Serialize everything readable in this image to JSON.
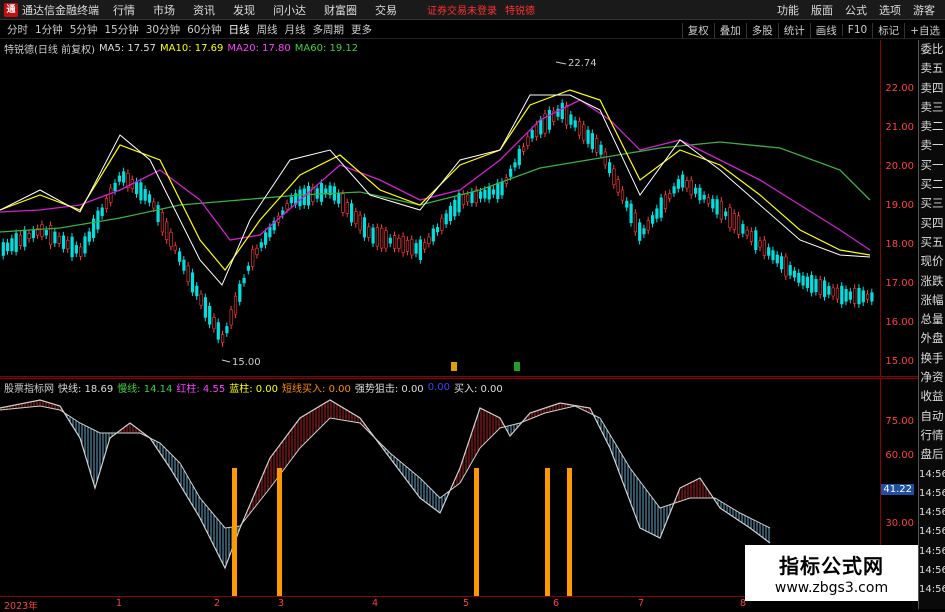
{
  "titlebar": {
    "app_title": "通达信金融终端",
    "logo": "通",
    "menus": [
      "行情",
      "市场",
      "资讯",
      "发现",
      "问小达",
      "财富圈",
      "交易"
    ],
    "alert": "证券交易未登录",
    "alert2": "特锐德",
    "right_menus": [
      "功能",
      "版面",
      "公式",
      "选项"
    ],
    "guest": "游客"
  },
  "periods": [
    "分时",
    "1分钟",
    "5分钟",
    "15分钟",
    "30分钟",
    "60分钟",
    "日线",
    "周线",
    "月线",
    "多周期",
    "更多"
  ],
  "tools": [
    "复权",
    "叠加",
    "多股",
    "统计",
    "画线",
    "F10",
    "标记",
    "+自选"
  ],
  "info": {
    "name": "特锐德(日线 前复权)",
    "ma5": "MA5: 17.57",
    "ma10": "MA10: 17.69",
    "ma20": "MA20: 17.80",
    "ma60": "MA60: 19.12"
  },
  "price_axis": [
    "22.00",
    "21.00",
    "20.00",
    "19.00",
    "18.00",
    "17.00",
    "16.00",
    "15.00"
  ],
  "annotations": {
    "high": "22.74",
    "low": "15.00"
  },
  "right_panel": [
    "委比",
    "卖五",
    "卖四",
    "卖三",
    "卖二",
    "卖一",
    "买一",
    "买二",
    "买三",
    "买四",
    "买五",
    "现价",
    "涨跌",
    "涨幅",
    "总量",
    "外盘",
    "换手",
    "净资",
    "收益",
    "自动",
    "行情",
    "盘后",
    "14:56",
    "14:56",
    "14:56",
    "14:56",
    "14:56",
    "14:56",
    "14:56"
  ],
  "indicator": {
    "name": "股票指标网",
    "fast": "快线: 18.69",
    "slow": "慢线: 14.14",
    "red": "红柱: 4.55",
    "blue": "蓝柱: 0.00",
    "short_buy": "短线买入: 0.00",
    "strong": "强势狙击: 0.00",
    "p1": "0.00",
    "p2": "0.00",
    "buy": "买入: 0.00"
  },
  "ind_axis": [
    "75.00",
    "60.00",
    "41.22",
    "30.00"
  ],
  "dates": [
    "2023年",
    "1",
    "2",
    "3",
    "4",
    "5",
    "6",
    "7",
    "8"
  ],
  "watermark": {
    "line1": "指标公式网",
    "line2": "www.zbgs3.com"
  },
  "chart_data": {
    "type": "candlestick",
    "x_range": "2023年 - 8",
    "ylim": [
      15,
      22.74
    ],
    "high": 22.74,
    "low": 15.0,
    "ma": {
      "MA5": 17.57,
      "MA10": 17.69,
      "MA20": 17.8,
      "MA60": 19.12
    }
  }
}
